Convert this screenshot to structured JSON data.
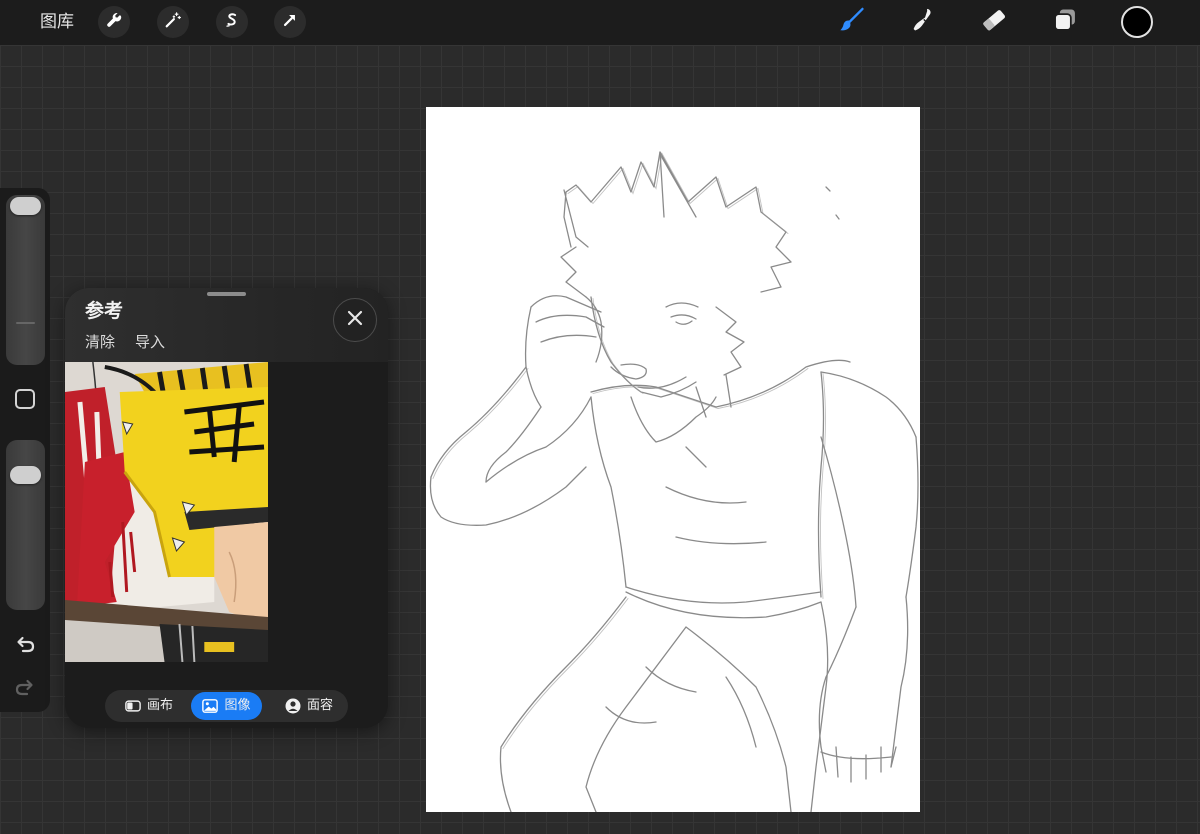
{
  "topbar": {
    "gallery_label": "图库",
    "actions": [
      {
        "icon": "wrench-icon"
      },
      {
        "icon": "magic-wand-icon"
      },
      {
        "icon": "selection-icon"
      },
      {
        "icon": "arrow-icon"
      }
    ],
    "tools": [
      {
        "icon": "brush-icon",
        "active": true
      },
      {
        "icon": "smudge-icon",
        "active": false
      },
      {
        "icon": "eraser-icon",
        "active": false
      },
      {
        "icon": "layers-icon",
        "active": false
      }
    ],
    "accent_color": "#2f8cff",
    "current_color": "#000000"
  },
  "sidebar": {
    "brush_size_level": 1.0,
    "opacity_level": 0.84,
    "modify_icon": "square-icon",
    "undo_icon": "undo-icon",
    "redo_icon": "redo-icon",
    "redo_enabled": false
  },
  "reference": {
    "title": "参考",
    "clear_label": "清除",
    "import_label": "导入",
    "close_icon": "close-icon",
    "selected_tab_color": "#1a7cf5",
    "tabs": [
      {
        "label": "画布",
        "icon": "canvas-icon",
        "selected": false
      },
      {
        "label": "图像",
        "icon": "image-icon",
        "selected": true
      },
      {
        "label": "面容",
        "icon": "face-icon",
        "selected": false
      }
    ]
  }
}
